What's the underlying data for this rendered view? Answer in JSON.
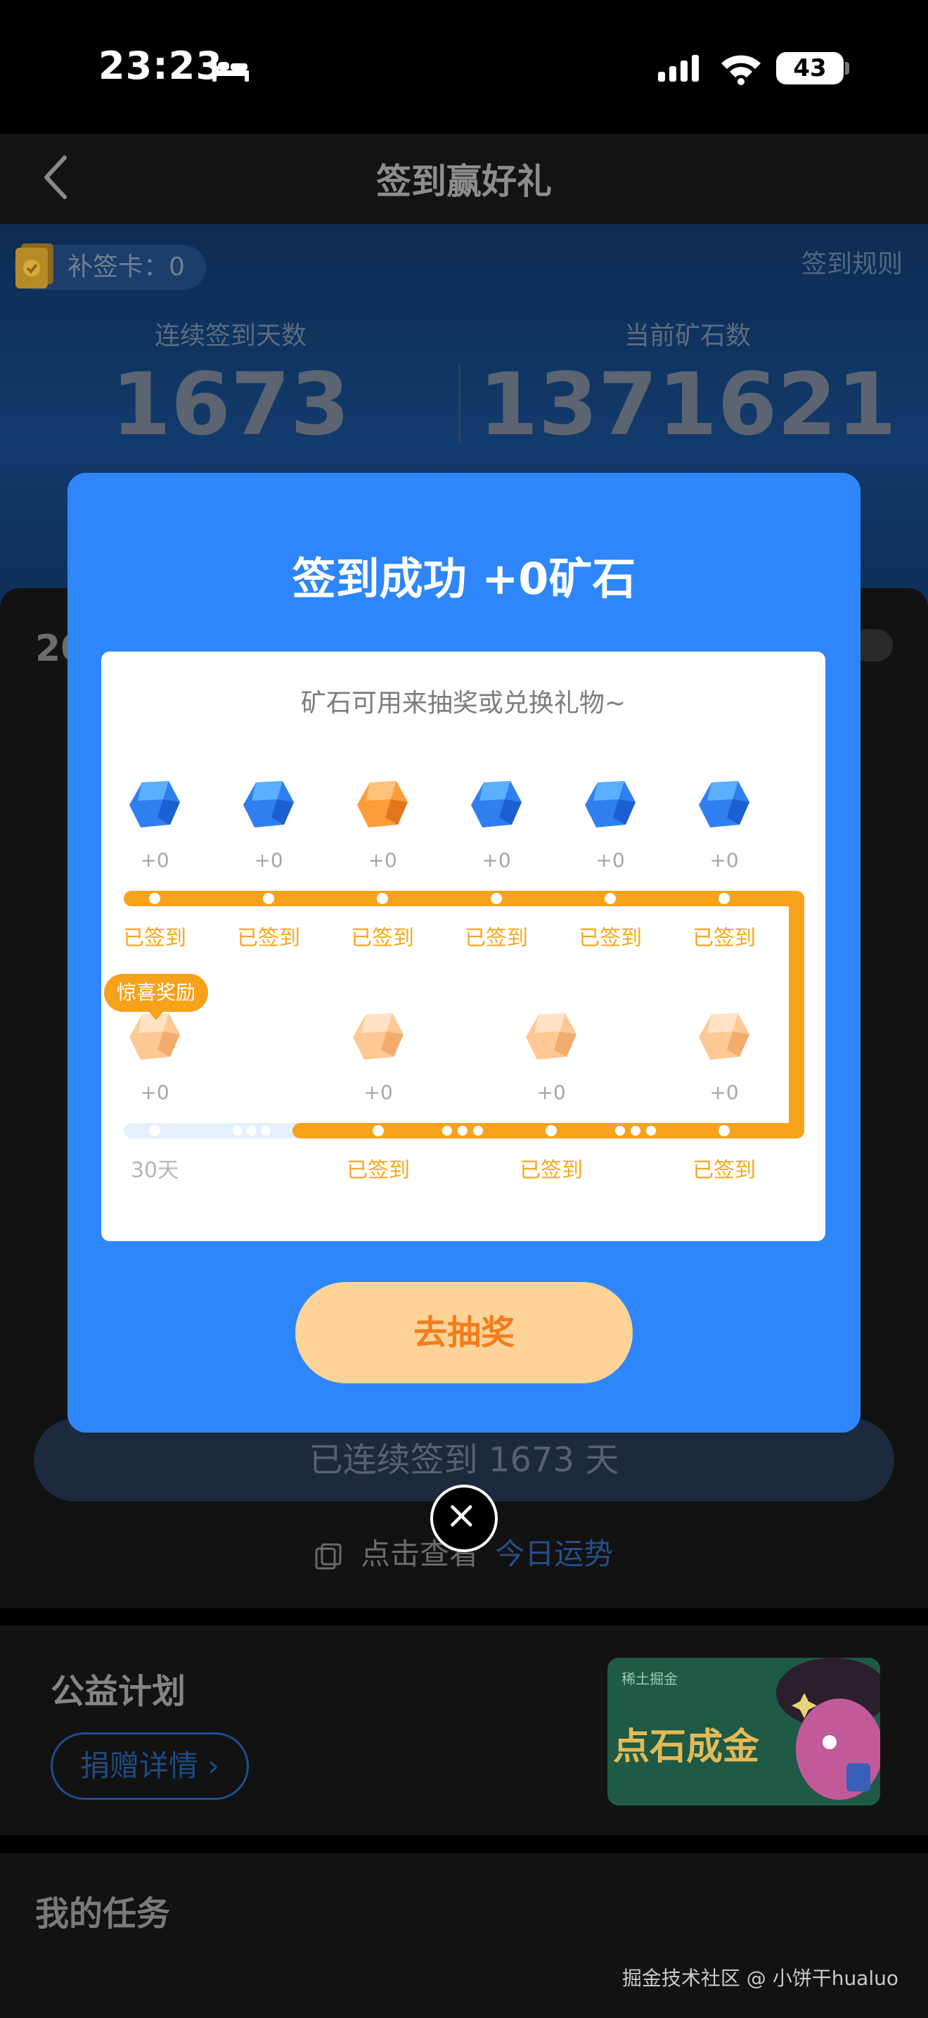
{
  "status_bar": {
    "time": "23:23",
    "battery": "43"
  },
  "nav": {
    "title": "签到赢好礼"
  },
  "hero": {
    "makeup_card": "补签卡：0",
    "rules": "签到规则",
    "streak_label": "连续签到天数",
    "streak_value": "1673",
    "ore_label": "当前矿石数",
    "ore_value": "1371621"
  },
  "page": {
    "year_peek": "20",
    "streak_banner": "已连续签到  1673  天",
    "fortune_prefix": "点击查看",
    "fortune_link": "今日运势"
  },
  "charity": {
    "title": "公益计划",
    "donate_label": "捐赠详情 ›",
    "banner_brand": "稀土掘金",
    "banner_text": "点石成金"
  },
  "tasks": {
    "title": "我的任务"
  },
  "watermark": "掘金技术社区 @ 小饼干hualuo",
  "modal": {
    "title": "签到成功 +0矿石",
    "subtitle": "矿石可用来抽奖或兑换礼物~",
    "draw_button": "去抽奖",
    "surprise_badge": "惊喜奖励",
    "colors": {
      "accent": "#2f86fb",
      "track": "#f7a21b",
      "button": "#fed397",
      "button_text": "#f27d1c"
    },
    "row1": [
      {
        "reward": "+0",
        "status": "已签到",
        "gem": "blue"
      },
      {
        "reward": "+0",
        "status": "已签到",
        "gem": "blue"
      },
      {
        "reward": "+0",
        "status": "已签到",
        "gem": "orange"
      },
      {
        "reward": "+0",
        "status": "已签到",
        "gem": "blue"
      },
      {
        "reward": "+0",
        "status": "已签到",
        "gem": "blue"
      },
      {
        "reward": "+0",
        "status": "已签到",
        "gem": "blue"
      }
    ],
    "row2": [
      {
        "reward": "+0",
        "status": "30天",
        "gem": "peach"
      },
      {
        "reward": "+0",
        "status": "已签到",
        "gem": "peach"
      },
      {
        "reward": "+0",
        "status": "已签到",
        "gem": "peach"
      },
      {
        "reward": "+0",
        "status": "已签到",
        "gem": "peach"
      }
    ]
  }
}
